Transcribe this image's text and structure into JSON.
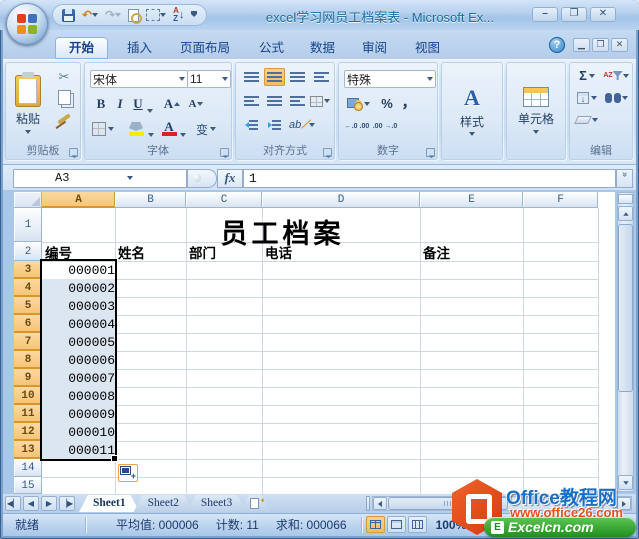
{
  "window": {
    "title": "excel学习网员工档案表 - Microsoft Ex...",
    "controls": {
      "minimize": "–",
      "restore": "❐",
      "close": "✕"
    }
  },
  "tabs": {
    "home": "开始",
    "insert": "插入",
    "page_layout": "页面布局",
    "formulas": "公式",
    "data": "数据",
    "review": "审阅",
    "view": "视图",
    "help": "?"
  },
  "ribbon": {
    "clipboard": {
      "group": "剪贴板",
      "paste": "粘贴"
    },
    "font": {
      "group": "字体",
      "name": "宋体",
      "size": "11",
      "bold": "B",
      "italic": "I",
      "underline": "U",
      "grow": "A",
      "shrink": "A",
      "font_color": "A",
      "phonetic": "变"
    },
    "alignment": {
      "group": "对齐方式",
      "orientation": "ab"
    },
    "number": {
      "group": "数字",
      "format": "特殊",
      "percent": "%",
      "comma": "，",
      "inc_decimal": "←.0 .00",
      "dec_decimal": ".00 →.0"
    },
    "styles": {
      "group": "样式"
    },
    "cells": {
      "group": "单元格"
    },
    "editing": {
      "group": "编辑",
      "autosum": "Σ",
      "sort_az": "AZ"
    }
  },
  "icons": {
    "undo": "↶",
    "redo": "↷",
    "scissors": "✂",
    "sort_a": "A",
    "sort_z": "Z",
    "arrow_down": "↓",
    "fx": "fx",
    "expand_formula_bar": "«"
  },
  "formula_bar": {
    "name_box": "A3",
    "value": "1"
  },
  "sheet": {
    "columns": [
      "A",
      "B",
      "C",
      "D",
      "E",
      "F"
    ],
    "rows": [
      "1",
      "2",
      "3",
      "4",
      "5",
      "6",
      "7",
      "8",
      "9",
      "10",
      "11",
      "12",
      "13",
      "14",
      "15"
    ],
    "title_cell": "员工档案",
    "headers": [
      "编号",
      "姓名",
      "部门",
      "电话",
      "备注"
    ],
    "ids": [
      "000001",
      "000002",
      "000003",
      "000004",
      "000005",
      "000006",
      "000007",
      "000008",
      "000009",
      "000010",
      "000011"
    ]
  },
  "sheet_tabs": {
    "sheet1": "Sheet1",
    "sheet2": "Sheet2",
    "sheet3": "Sheet3"
  },
  "status": {
    "mode": "就绪",
    "average": "平均值: 000006",
    "count": "计数: 11",
    "sum": "求和: 000066",
    "zoom": "100%"
  },
  "watermark": {
    "brand": "Office教程网",
    "url": "www.office26.com",
    "badge": "Excelcn.com",
    "badge_icon": "E"
  }
}
